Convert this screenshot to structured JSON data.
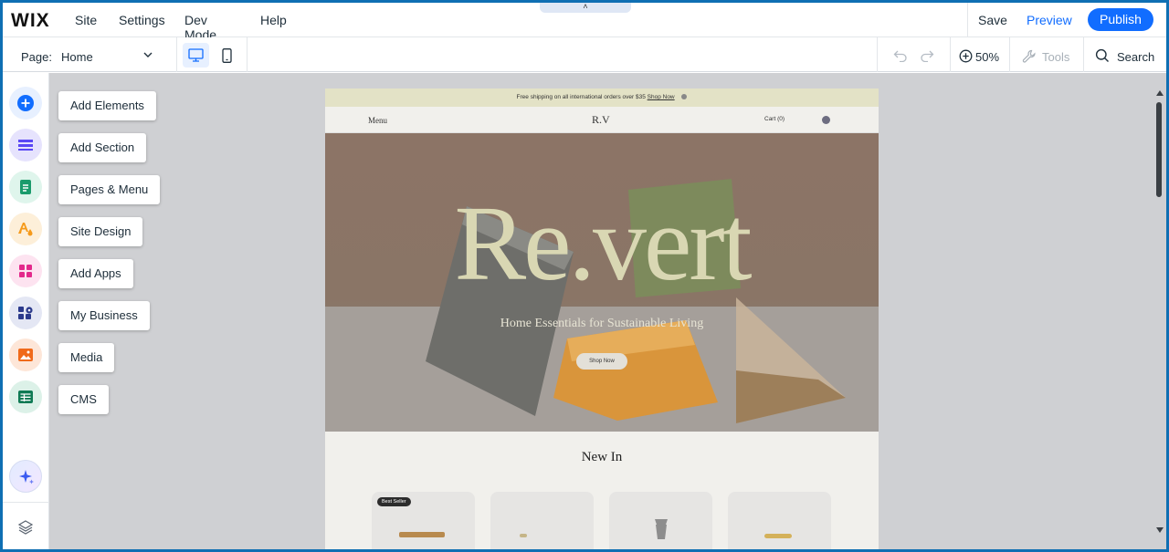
{
  "topbar": {
    "logo": "WIX",
    "menu": [
      "Site",
      "Settings",
      "Dev Mode",
      "Help"
    ],
    "save": "Save",
    "preview": "Preview",
    "publish": "Publish",
    "collapse_glyph": "˄"
  },
  "subbar": {
    "page_label": "Page:",
    "page_value": "Home",
    "zoom": "50%",
    "tools": "Tools",
    "search": "Search"
  },
  "add_panel": {
    "items": [
      "Add Elements",
      "Add Section",
      "Pages & Menu",
      "Site Design",
      "Add Apps",
      "My Business",
      "Media",
      "CMS"
    ]
  },
  "sidebar_icons": [
    {
      "icon": "plus-circle-icon",
      "color": "#116dff",
      "bg": "#e7f0ff"
    },
    {
      "icon": "section-icon",
      "color": "#5a48f5",
      "bg": "#e6e3fd"
    },
    {
      "icon": "page-icon",
      "color": "#1a9b6c",
      "bg": "#dff5ec"
    },
    {
      "icon": "design-icon",
      "color": "#f59a1b",
      "bg": "#fdefd9"
    },
    {
      "icon": "apps-icon",
      "color": "#e3298b",
      "bg": "#fde3f0"
    },
    {
      "icon": "business-icon",
      "color": "#2b3a8c",
      "bg": "#e4e7f4"
    },
    {
      "icon": "media-icon",
      "color": "#f06a1a",
      "bg": "#fde6d8"
    },
    {
      "icon": "cms-icon",
      "color": "#0f7a54",
      "bg": "#dcf1e8"
    }
  ],
  "site": {
    "announcement": "Free shipping on all international orders over $35",
    "announcement_link": "Shop Now",
    "nav_menu": "Menu",
    "nav_logo": "R.V",
    "nav_cart": "Cart (0)",
    "hero_title": "Re.vert",
    "hero_subtitle": "Home Essentials for Sustainable Living",
    "hero_button": "Shop Now",
    "section_title": "New In",
    "badge": "Best Seller"
  }
}
